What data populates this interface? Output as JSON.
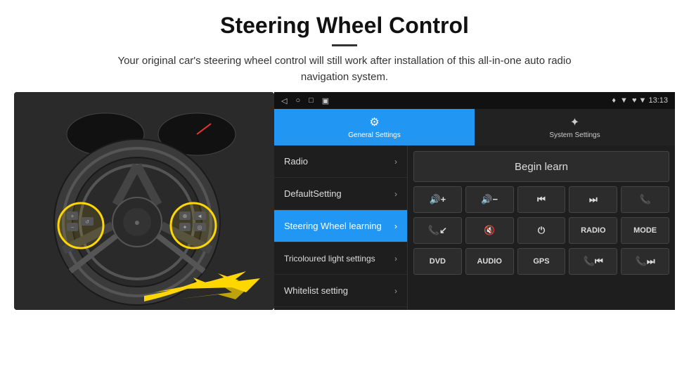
{
  "header": {
    "title": "Steering Wheel Control",
    "subtitle": "Your original car's steering wheel control will still work after installation of this all-in-one auto radio navigation system."
  },
  "statusBar": {
    "icons": [
      "◁",
      "○",
      "□",
      "▣"
    ],
    "rightInfo": "♥ ▼  13:13"
  },
  "tabs": [
    {
      "label": "General Settings",
      "active": true
    },
    {
      "label": "System Settings",
      "active": false
    }
  ],
  "menuItems": [
    {
      "label": "Radio",
      "active": false
    },
    {
      "label": "DefaultSetting",
      "active": false
    },
    {
      "label": "Steering Wheel learning",
      "active": true
    },
    {
      "label": "Tricoloured light settings",
      "active": false
    },
    {
      "label": "Whitelist setting",
      "active": false
    }
  ],
  "beginLearn": "Begin learn",
  "controlButtons": {
    "row1": [
      "🔊+",
      "🔊−",
      "⏮",
      "⏭",
      "📞"
    ],
    "row2": [
      "📞↙",
      "🔇",
      "⏻",
      "RADIO",
      "MODE"
    ],
    "row3": [
      "DVD",
      "AUDIO",
      "GPS",
      "📞⏮",
      "📞⏭"
    ]
  },
  "controlButtonsText": {
    "row1": [
      "◄+",
      "◄−",
      "|◄◄",
      "►►|",
      "☎"
    ],
    "row2": [
      "↙",
      "◄✕",
      "⏻",
      "RADIO",
      "MODE"
    ],
    "row3": [
      "DVD",
      "AUDIO",
      "GPS",
      "☎|◄◄",
      "☎►►|"
    ]
  }
}
